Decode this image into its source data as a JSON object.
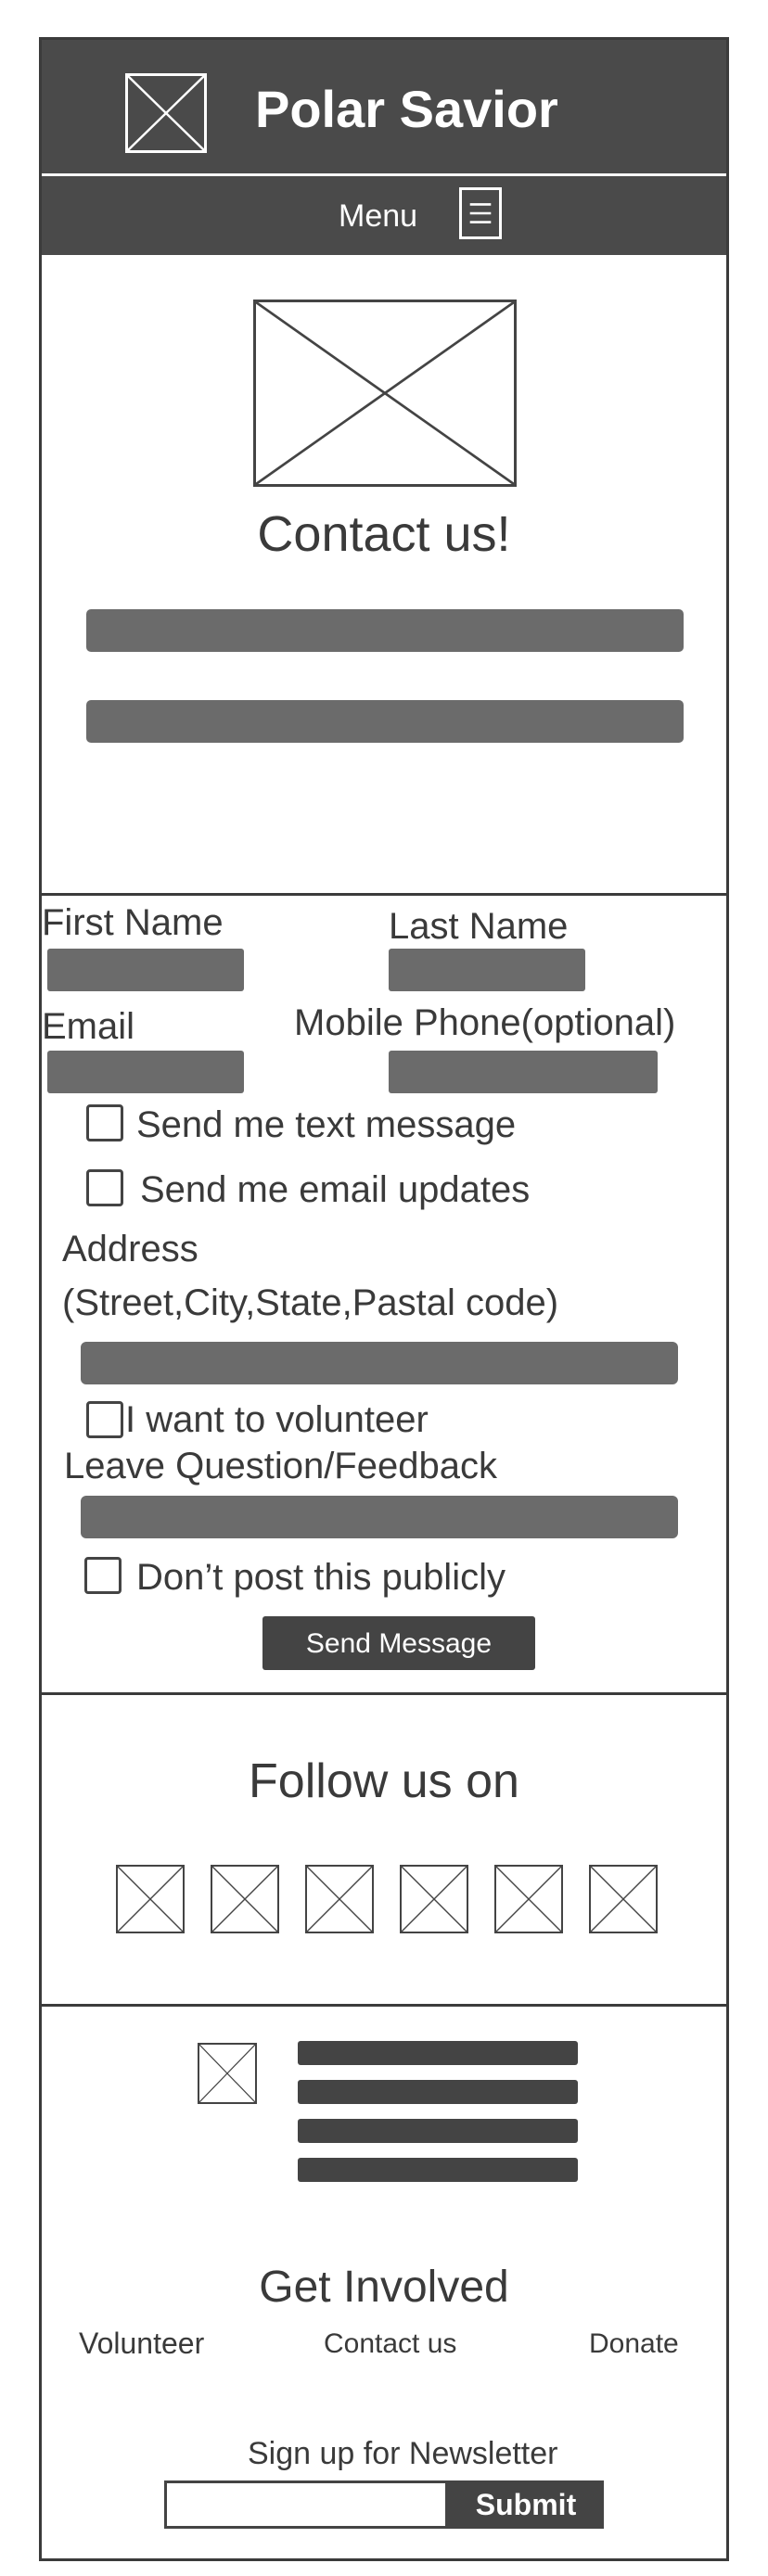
{
  "header": {
    "title": "Polar Savior",
    "logo_icon": "image-placeholder-icon"
  },
  "nav": {
    "menu_label": "Menu",
    "menu_icon": "hamburger-icon"
  },
  "hero": {
    "image_icon": "image-placeholder-icon",
    "title": "Contact us!"
  },
  "form": {
    "first_name_label": "First Name",
    "last_name_label": "Last Name",
    "email_label": "Email",
    "phone_label": "Mobile Phone(optional)",
    "text_message_label": "Send me text message",
    "email_updates_label": "Send me email updates",
    "address_label": "Address",
    "address_hint": "(Street,City,State,Pastal code)",
    "volunteer_label": "I want to volunteer",
    "feedback_label": "Leave Question/Feedback",
    "private_label": "Don’t post this publicly",
    "send_label": "Send Message"
  },
  "social": {
    "title": "Follow us on",
    "icons": [
      "social-icon",
      "social-icon",
      "social-icon",
      "social-icon",
      "social-icon",
      "social-icon"
    ]
  },
  "footer": {
    "get_involved": "Get Involved",
    "links": [
      "Volunteer",
      "Contact us",
      "Donate"
    ],
    "newsletter_label": "Sign up for Newsletter",
    "submit_label": "Submit"
  },
  "colors": {
    "header_bg": "#4a4a4a",
    "field": "#6b6b6b",
    "button": "#444444",
    "text": "#3a3a3a"
  }
}
